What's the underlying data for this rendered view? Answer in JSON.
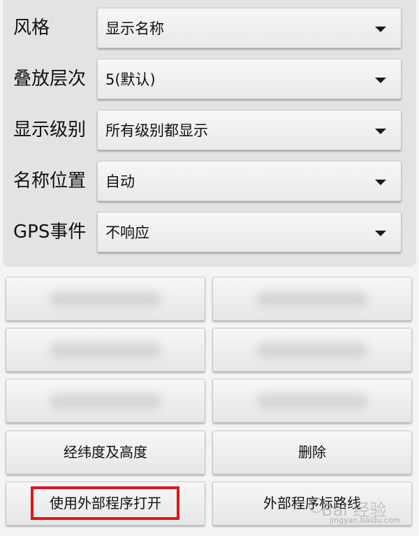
{
  "settings": {
    "style": {
      "label": "风格",
      "value": "显示名称"
    },
    "stack_order": {
      "label": "叠放层次",
      "value": "5(默认)"
    },
    "display_level": {
      "label": "显示级别",
      "value": "所有级别都显示"
    },
    "name_position": {
      "label": "名称位置",
      "value": "自动"
    },
    "gps_event": {
      "label": "GPS事件",
      "value": "不响应"
    }
  },
  "buttons": {
    "lat_lon_alt": "经纬度及高度",
    "delete": "删除",
    "open_external": "使用外部程序打开",
    "external_route": "外部程序标路线"
  },
  "watermark": {
    "text": "Bai 经验",
    "url": "jingyan.baidu.com"
  },
  "colors": {
    "highlight": "#e0141b",
    "panel": "#e3e3e3"
  }
}
